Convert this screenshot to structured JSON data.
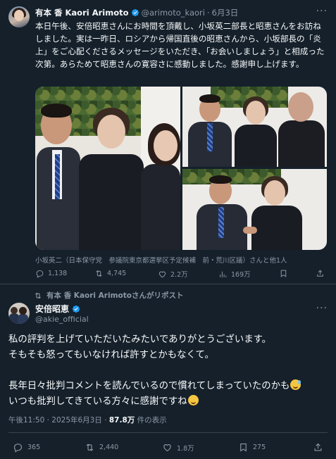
{
  "tweet1": {
    "author_name": "有本 香 Kaori Arimoto",
    "handle": "@arimoto_kaori",
    "separator": "·",
    "date": "6月3日",
    "text": "本日午後、安倍昭恵さんにお時間を頂戴し、小坂英二部長と昭恵さんをお訪ねしました。実は一昨日、ロシアから帰国直後の昭恵さんから、小坂部長の「炎上」をご心配くださるメッセージをいただき、「お会いしましょう」と相成った次第。あらためて昭恵さんの寛容さに感動しました。感謝申し上げます。",
    "photo_tag": "小坂英二（日本保守党　参議院東京都選挙区予定候補　前・荒川区議）さんと他1人",
    "replies": "1,138",
    "reposts": "4,745",
    "likes": "2.2万",
    "views": "169万"
  },
  "repost_label": "有本 香 Kaori Arimotoさんがリポスト",
  "tweet2": {
    "author_name": "安倍昭恵",
    "handle": "@akie_official",
    "lines": [
      "私の評判を上げていただいたみたいでありがとうございます。",
      "そもそも怒ってもいなければ許すとかもなくて。",
      "長年日々批判コメントを読んでいるので慣れてしまっていたのかも",
      "いつも批判してきている方々に感謝ですね"
    ],
    "time": "午後11:50 · 2025年6月3日 · ",
    "views_count": "87.8万",
    "views_label": " 件の表示",
    "replies": "365",
    "reposts": "2,440",
    "likes": "1.8万",
    "bookmarks": "275"
  },
  "colors": {
    "background": "#15202b",
    "text": "#f7f9f9",
    "muted": "#8b98a5",
    "verified": "#1d9bf0",
    "border": "#38444d"
  },
  "icons": [
    "verified-badge-icon",
    "more-icon",
    "reply-icon",
    "repost-icon",
    "like-icon",
    "views-icon",
    "bookmark-icon",
    "share-icon"
  ]
}
